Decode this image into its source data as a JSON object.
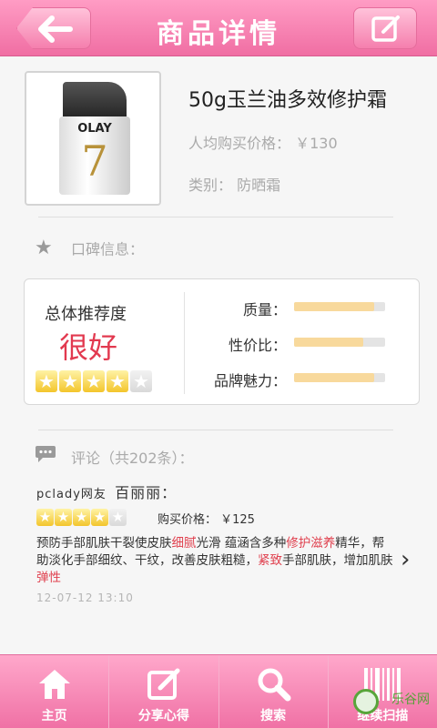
{
  "header": {
    "title": "商品详情",
    "back_icon": "arrow-left-icon",
    "edit_icon": "edit-icon"
  },
  "product": {
    "brand_on_image": "OLAY",
    "image_number": "7",
    "name": "50g玉兰油多效修护霜",
    "price_line": "人均购买价格： ￥130",
    "category_line": "类别： 防晒霜"
  },
  "reputation": {
    "heading": "口碑信息：",
    "overall_label": "总体推荐度",
    "overall_value": "很好",
    "stars": 4,
    "max_stars": 5,
    "metrics": [
      {
        "label": "质量：",
        "fraction": 0.88
      },
      {
        "label": "性价比：",
        "fraction": 0.76
      },
      {
        "label": "品牌魅力：",
        "fraction": 0.88
      }
    ]
  },
  "comments": {
    "heading": "评论（共202条）：",
    "items": [
      {
        "source": "pclady网友",
        "nickname": "百丽丽：",
        "stars": 4,
        "price": "购买价格： ￥125",
        "text_parts": [
          {
            "t": "预防手部肌肤干裂使皮肤",
            "hl": false
          },
          {
            "t": "细腻",
            "hl": true
          },
          {
            "t": "光滑 蕴涵含多种",
            "hl": false
          },
          {
            "t": "修护滋养",
            "hl": true
          },
          {
            "t": "精华，帮助淡化手部细纹、干纹，改善皮肤粗糙，",
            "hl": false
          },
          {
            "t": "紧致",
            "hl": true
          },
          {
            "t": "手部肌肤，增加肌肤",
            "hl": false
          },
          {
            "t": "弹性",
            "hl": true
          }
        ],
        "time": "12-07-12  13:10"
      }
    ]
  },
  "nav": [
    {
      "label": "主页",
      "icon": "home-icon"
    },
    {
      "label": "分享心得",
      "icon": "edit-icon"
    },
    {
      "label": "搜索",
      "icon": "search-icon"
    },
    {
      "label": "继续扫描",
      "icon": "barcode-icon"
    }
  ],
  "watermark": "乐谷网",
  "colors": {
    "header_pink": "#f06ea3",
    "highlight_red": "#e0414f",
    "bar_fill": "#f8d99c"
  }
}
